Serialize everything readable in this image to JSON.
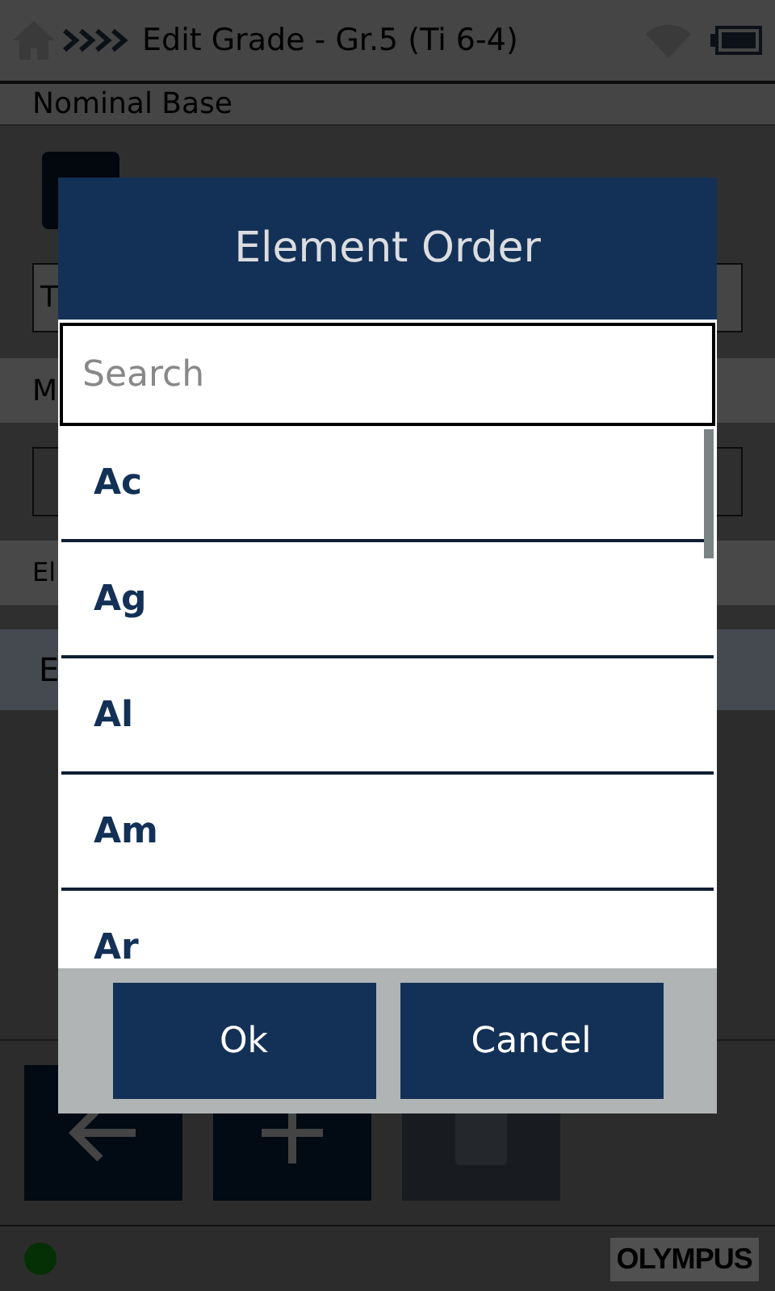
{
  "header": {
    "title": "Edit Grade - Gr.5 (Ti 6-4)"
  },
  "form": {
    "heading": "Nominal Base",
    "field_text": "T",
    "label_1": "M",
    "label_2": "El",
    "section": "E"
  },
  "toolbar": [
    {
      "kind": "back",
      "disabled": false
    },
    {
      "kind": "add",
      "disabled": false
    },
    {
      "kind": "delete",
      "disabled": true
    }
  ],
  "status_bar": {
    "logo": "OLYMPUS"
  },
  "dialog": {
    "title": "Element Order",
    "search": {
      "placeholder": "Search"
    },
    "items": [
      {
        "label": "Ac"
      },
      {
        "label": "Ag"
      },
      {
        "label": "Al"
      },
      {
        "label": "Am"
      },
      {
        "label": "Ar"
      }
    ],
    "buttons": [
      "Ok",
      "Cancel"
    ]
  }
}
